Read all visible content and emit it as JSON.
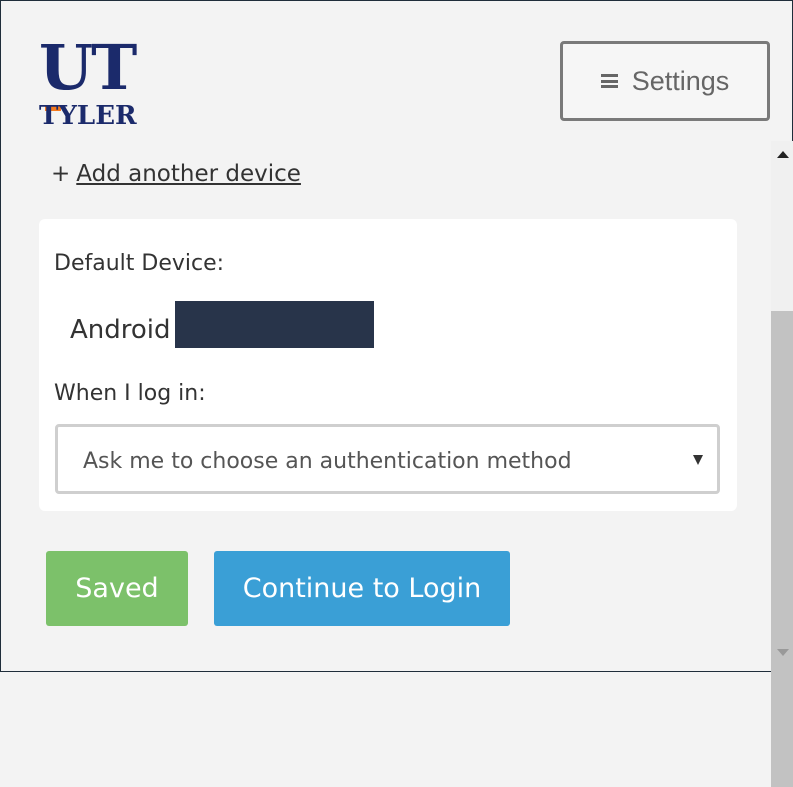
{
  "logo": {
    "line1": "UT",
    "line2": "TYLER"
  },
  "header": {
    "settings_label": "Settings",
    "settings_icon": "hamburger-menu-icon"
  },
  "devices": {
    "add_prefix": "+",
    "add_link": "Add another device"
  },
  "panel": {
    "default_device_label": "Default Device:",
    "device_name": "Android",
    "login_label": "When I log in:",
    "auth_method_selected": "Ask me to choose an authentication method"
  },
  "actions": {
    "saved_label": "Saved",
    "continue_label": "Continue to Login"
  },
  "colors": {
    "brand_navy": "#1b2a6b",
    "brand_orange": "#f47b20",
    "saved_green": "#7cc16a",
    "continue_blue": "#3a9fd6",
    "redaction": "#28344a"
  }
}
